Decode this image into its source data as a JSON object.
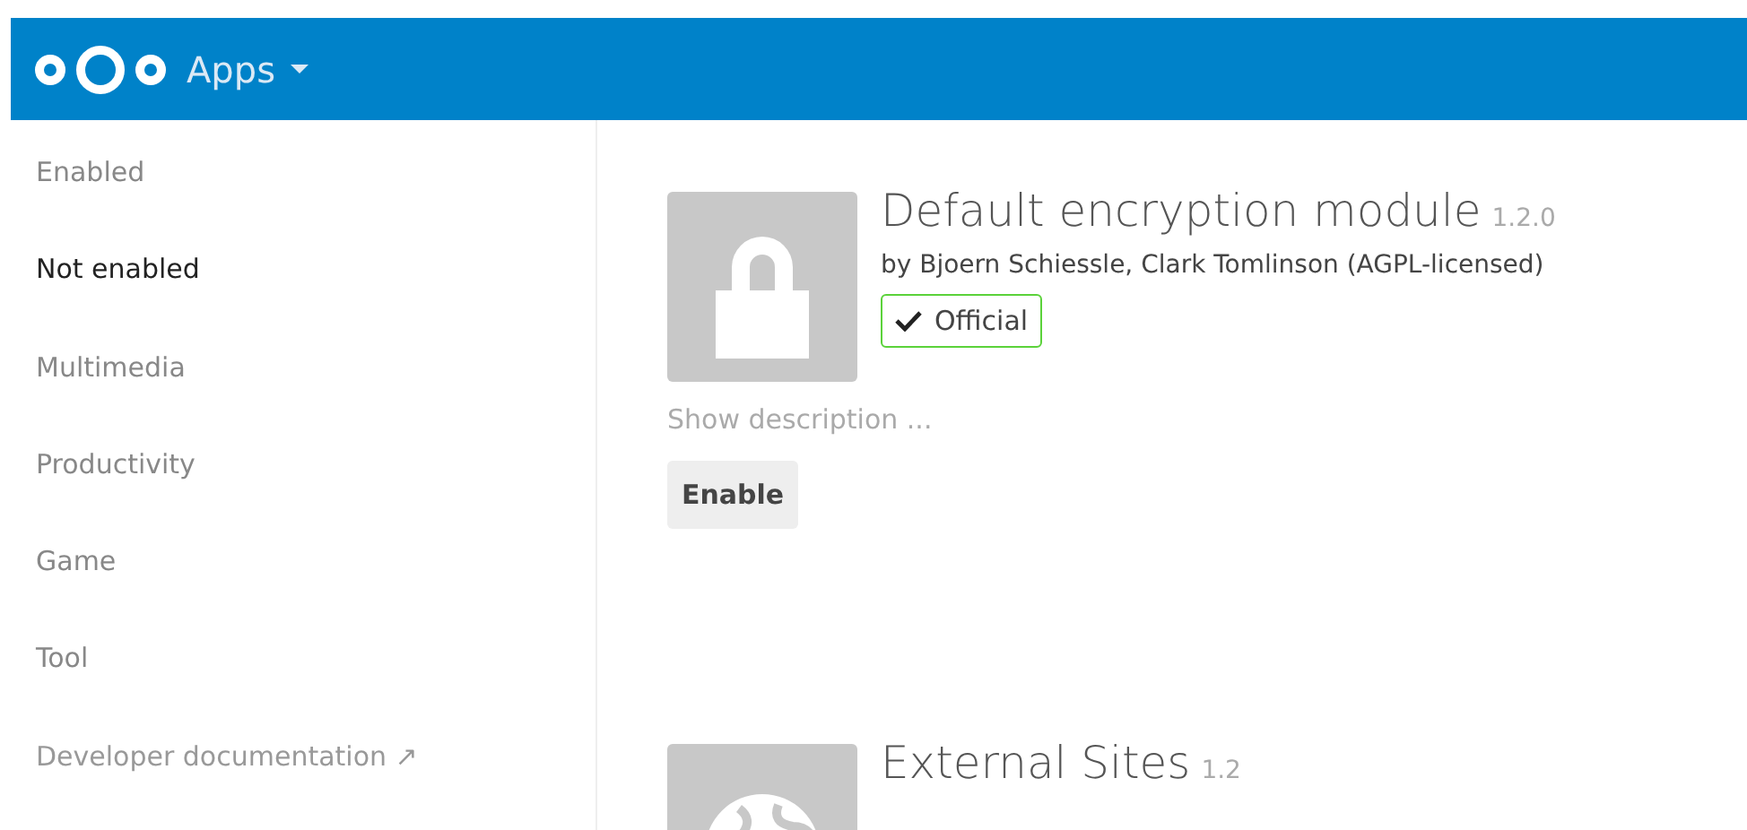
{
  "header": {
    "title": "Apps"
  },
  "sidebar": {
    "items": [
      {
        "label": "Enabled",
        "selected": false,
        "kind": "category"
      },
      {
        "label": "Not enabled",
        "selected": true,
        "kind": "category"
      },
      {
        "label": "Multimedia",
        "selected": false,
        "kind": "category"
      },
      {
        "label": "Productivity",
        "selected": false,
        "kind": "category"
      },
      {
        "label": "Game",
        "selected": false,
        "kind": "category"
      },
      {
        "label": "Tool",
        "selected": false,
        "kind": "category"
      },
      {
        "label": "Developer documentation ↗",
        "selected": false,
        "kind": "link"
      }
    ]
  },
  "apps": [
    {
      "kind": "lock",
      "name": "Default encryption module",
      "version": "1.2.0",
      "author": "by Bjoern Schiessle, Clark Tomlinson (AGPL-licensed)",
      "official": true,
      "official_label": "Official",
      "description_toggle": "Show description ...",
      "button": "Enable"
    },
    {
      "kind": "globe",
      "name": "External Sites",
      "version": "1.2"
    }
  ]
}
